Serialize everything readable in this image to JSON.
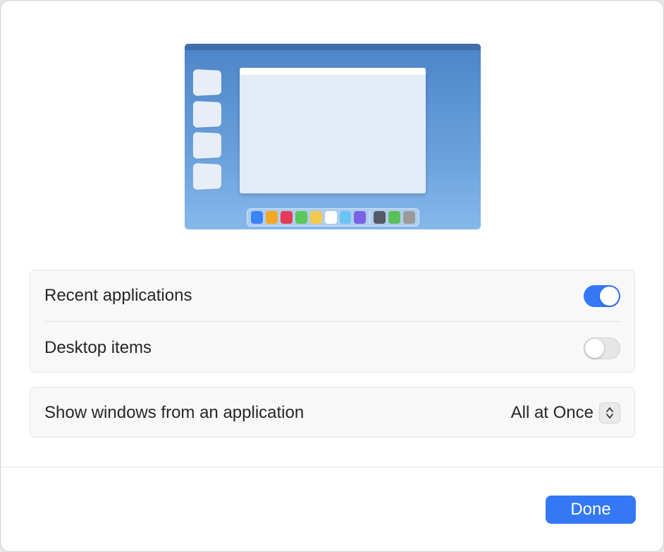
{
  "colors": {
    "accent": "#3478f6",
    "toggle_off": "#e6e6e6",
    "group_bg": "#f8f8f8"
  },
  "preview": {
    "dock_apps": [
      "#3b82f6",
      "#f5a623",
      "#e23c5a",
      "#5ac85a",
      "#f2c94c",
      "#ffffff",
      "#6cc3f2",
      "#7b61e5",
      "#555a66",
      "#5bbf5b",
      "#9a9a9a"
    ]
  },
  "settings": {
    "recent_applications": {
      "label": "Recent applications",
      "enabled": true,
      "icon": "toggle-switch"
    },
    "desktop_items": {
      "label": "Desktop items",
      "enabled": false,
      "icon": "toggle-switch"
    },
    "show_windows": {
      "label": "Show windows from an application",
      "value": "All at Once",
      "icon": "chevron-up-down-icon"
    }
  },
  "footer": {
    "done_label": "Done"
  }
}
